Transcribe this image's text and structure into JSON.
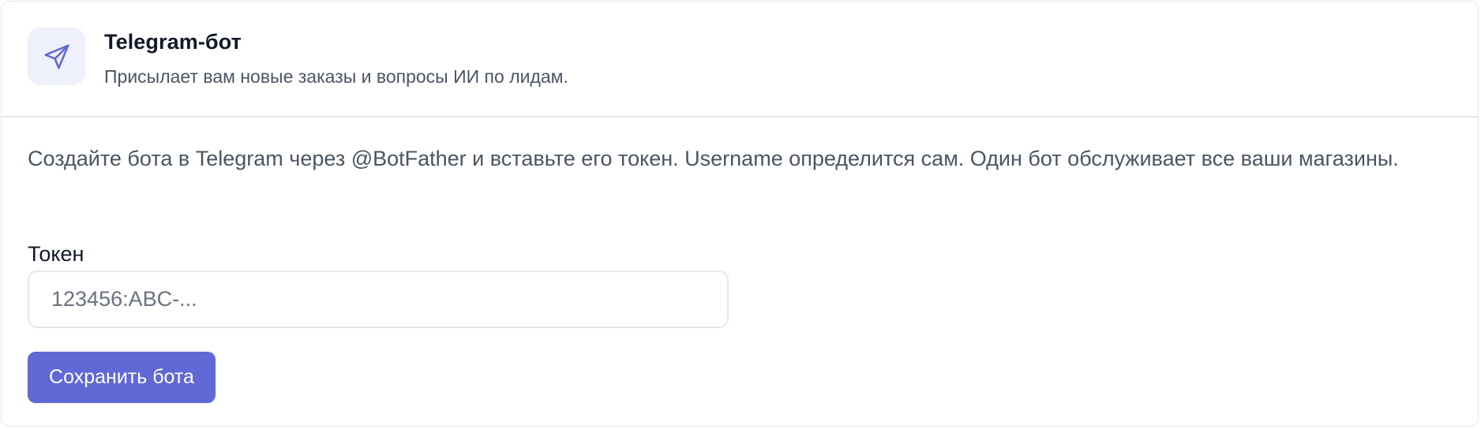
{
  "header": {
    "icon": "send-icon",
    "title": "Telegram-бот",
    "subtitle": "Присылает вам новые заказы и вопросы ИИ по лидам."
  },
  "body": {
    "description": "Создайте бота в Telegram через @BotFather и вставьте его токен. Username определится сам. Один бот обслуживает все ваши магазины.",
    "token_label": "Токен",
    "token_value": "",
    "token_placeholder": "123456:ABC-...",
    "save_label": "Сохранить бота"
  },
  "colors": {
    "accent": "#5f68d4",
    "icon_bg": "#eef0fb",
    "border": "#e5e7eb"
  }
}
